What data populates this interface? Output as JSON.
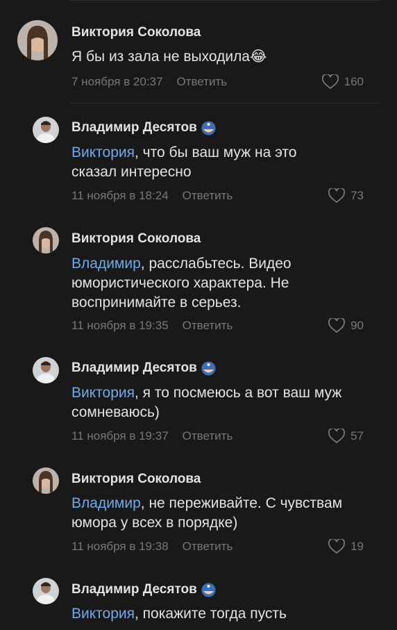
{
  "comments": [
    {
      "author": "Виктория Соколова",
      "mention": "",
      "text": "Я бы из зала не выходила",
      "text2": "",
      "date": "7 ноября в 20:37",
      "reply": "Ответить",
      "likes": "160",
      "emoji_after_text": "😂"
    },
    {
      "author": "Владимир Десятов",
      "mention": "Виктория",
      "text": ", что бы ваш муж на это",
      "text2": "сказал интересно",
      "date": "11 ноября в 18:24",
      "reply": "Ответить",
      "likes": "73"
    },
    {
      "author": "Виктория Соколова",
      "mention": "Владимир",
      "text": ", расслабьтесь. Видео",
      "text2": "юмористического характера. Не",
      "text3": "воспринимайте в серьез.",
      "date": "11 ноября в 19:35",
      "reply": "Ответить",
      "likes": "90"
    },
    {
      "author": "Владимир Десятов",
      "mention": "Виктория",
      "text": ", я то посмеюсь а вот ваш муж",
      "text2": "сомневаюсь)",
      "date": "11 ноября в 19:37",
      "reply": "Ответить",
      "likes": "57"
    },
    {
      "author": "Виктория Соколова",
      "mention": "Владимир",
      "text": ", не переживайте. С чувствам",
      "text2": "юмора у всех в порядке)",
      "date": "11 ноября в 19:38",
      "reply": "Ответить",
      "likes": "19"
    },
    {
      "author": "Владимир Десятов",
      "mention": "Виктория",
      "text": ", покажите тогда  пусть"
    }
  ],
  "colors": {
    "background": "#19191a",
    "text": "#e1e3e6",
    "mention": "#71aaeb",
    "secondary": "#76787a"
  },
  "icons": {
    "like": "heart-outline-icon",
    "badge": "captain-america-emoji-icon"
  }
}
